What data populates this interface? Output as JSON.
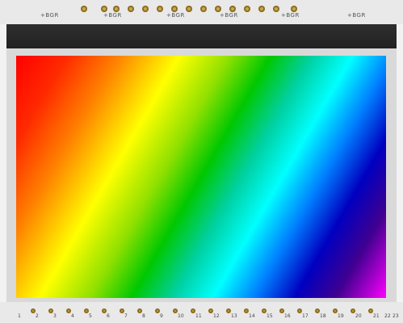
{
  "labels": {
    "top": [
      "+BGR",
      "+BGR",
      "+BGR",
      "+BGR",
      "+BGR",
      "+BGR"
    ],
    "bottom_numbers": [
      "1",
      "2",
      "3",
      "4",
      "5",
      "6",
      "7",
      "8",
      "9",
      "10",
      "11",
      "12",
      "13",
      "14",
      "15",
      "16",
      "17",
      "18",
      "19",
      "20",
      "21",
      "22",
      "23"
    ]
  },
  "colors": {
    "pcb": "#e9e9e9",
    "pad": "#c9a64a",
    "strip": "#2a2a2a",
    "gradient": [
      "#ff0000",
      "#ff8000",
      "#ffff00",
      "#00c800",
      "#00ffff",
      "#0000c0",
      "#ff00ff"
    ]
  }
}
